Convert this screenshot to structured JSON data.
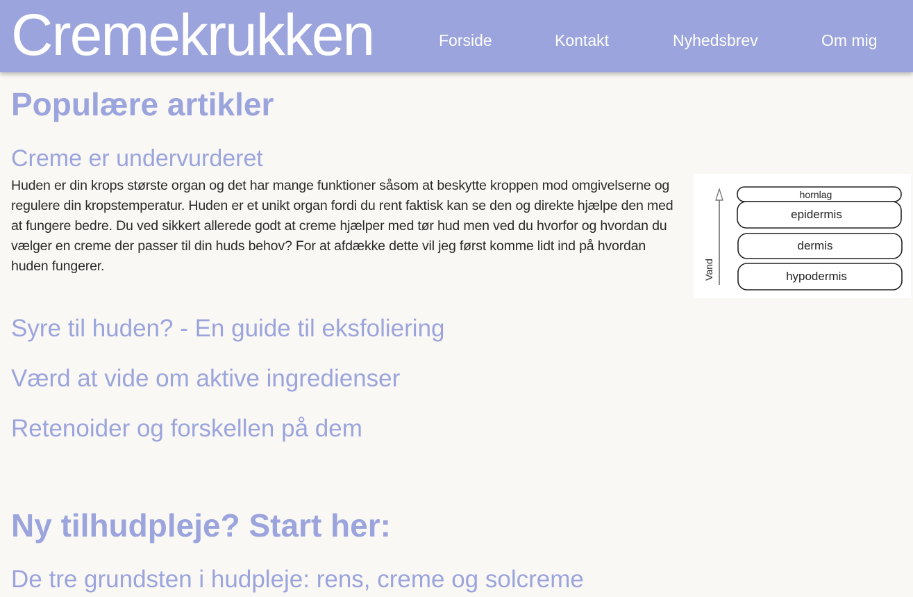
{
  "header": {
    "logo": "Cremekrukken",
    "nav": [
      "Forside",
      "Kontakt",
      "Nyhedsbrev",
      "Om mig"
    ]
  },
  "popular": {
    "title": "Populære artikler",
    "featured": {
      "title": "Creme er undervurderet",
      "text": "Huden er din krops største organ og det har mange funktioner såsom at beskytte kroppen mod omgivelserne og regulere din kropstemperatur. Huden er et unikt organ fordi du rent faktisk kan se den og direkte hjælpe den med at fungere bedre. Du ved sikkert allerede godt at creme hjælper med tør hud men ved du hvorfor og hvordan du vælger en creme der passer til din huds behov? For at afdække dette vil jeg først komme lidt ind på hvordan huden fungerer.",
      "figure": {
        "layers": [
          "hornlag",
          "epidermis",
          "dermis",
          "hypodermis"
        ],
        "axis_label": "Vand"
      }
    },
    "articles": [
      "Syre til huden? - En guide til eksfoliering",
      "Værd at vide om aktive ingredienser",
      "Retenoider og forskellen på dem"
    ]
  },
  "start": {
    "title": "Ny tilhudpleje? Start her:",
    "articles": [
      "De tre grundsten i hudpleje: rens, creme og solcreme"
    ]
  },
  "colors": {
    "accent": "#9ba4dc",
    "background": "#faf8f4",
    "header_text": "#ffffff",
    "body_text": "#2a2a2a"
  }
}
